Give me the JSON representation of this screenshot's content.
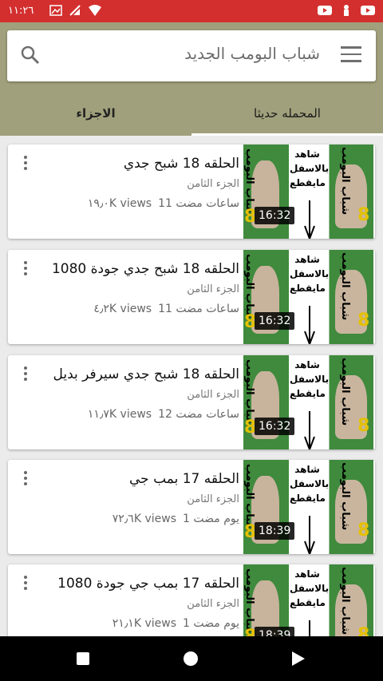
{
  "status": {
    "time": "١١:٢٦"
  },
  "search": {
    "text": "شباب البومب الجديد"
  },
  "tabs": [
    {
      "label": "الاجزاء"
    },
    {
      "label": "المحمله حديثا"
    }
  ],
  "videos": [
    {
      "title": "الحلقه 18 شبح جدي",
      "part": "الجزء الثامن",
      "time_ago": "11 ساعات مضت",
      "views": "١٩٫٠K views",
      "duration": "16:32"
    },
    {
      "title": "الحلقه 18 شبح جدي جودة 1080",
      "part": "الجزء الثامن",
      "time_ago": "11 ساعات مضت",
      "views": "٤٫٢K views",
      "duration": "16:32"
    },
    {
      "title": "الحلقه 18 شبح جدي سيرفر بديل",
      "part": "الجزء الثامن",
      "time_ago": "12 ساعات مضت",
      "views": "١١٫٧K views",
      "duration": "16:32"
    },
    {
      "title": "الحلقه 17 بمب جي",
      "part": "الجزء الثامن",
      "time_ago": "1 يوم مضت",
      "views": "٧٢٫٦K views",
      "duration": "18:39"
    },
    {
      "title": "الحلقه 17 بمب جي جودة 1080",
      "part": "الجزء الثامن",
      "time_ago": "1 يوم مضت",
      "views": "٢١٫١K views",
      "duration": "18:39"
    }
  ],
  "thumb": {
    "side_text": "شباب البومب",
    "mid_lines": [
      "شاهد",
      "بالاسفل",
      "مايقطع"
    ],
    "digit": "8"
  },
  "colors": {
    "status_bar": "#d32f2f",
    "app_bar": "#a0a07c"
  }
}
